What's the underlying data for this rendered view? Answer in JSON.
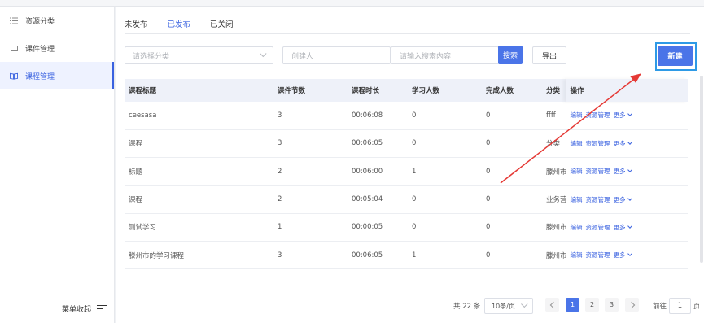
{
  "sidebar": {
    "items": [
      {
        "label": "资源分类",
        "icon": "list-icon",
        "active": false
      },
      {
        "label": "课件管理",
        "icon": "folder-icon",
        "active": false
      },
      {
        "label": "课程管理",
        "icon": "book-icon",
        "active": true
      }
    ],
    "collapse_label": "菜单收起"
  },
  "tabs": [
    {
      "label": "未发布",
      "active": false
    },
    {
      "label": "已发布",
      "active": true
    },
    {
      "label": "已关闭",
      "active": false
    }
  ],
  "filters": {
    "category_placeholder": "请选择分类",
    "creator_placeholder": "创建人",
    "search_placeholder": "请输入搜索内容",
    "search_button": "搜索",
    "export_button": "导出",
    "new_button": "新建"
  },
  "table": {
    "headers": [
      "课程标题",
      "课件节数",
      "课程时长",
      "学习人数",
      "完成人数",
      "分类",
      "操作"
    ],
    "rows": [
      {
        "title": "ceesasa",
        "lessons": "3",
        "duration": "00:06:08",
        "learners": "0",
        "completed": "0",
        "category": "ffff"
      },
      {
        "title": "课程",
        "lessons": "3",
        "duration": "00:06:05",
        "learners": "0",
        "completed": "0",
        "category": "分类"
      },
      {
        "title": "标题",
        "lessons": "2",
        "duration": "00:06:00",
        "learners": "1",
        "completed": "0",
        "category": "滕州市"
      },
      {
        "title": "课程",
        "lessons": "2",
        "duration": "00:05:04",
        "learners": "0",
        "completed": "0",
        "category": "业务营"
      },
      {
        "title": "测试学习",
        "lessons": "1",
        "duration": "00:00:05",
        "learners": "0",
        "completed": "0",
        "category": "滕州市"
      },
      {
        "title": "滕州市的学习课程",
        "lessons": "3",
        "duration": "00:06:05",
        "learners": "1",
        "completed": "0",
        "category": "滕州市"
      }
    ],
    "ops": {
      "edit": "编辑",
      "resources": "资源管理",
      "more": "更多"
    }
  },
  "pagination": {
    "total": "共 22 条",
    "page_size": "10条/页",
    "pages": [
      "1",
      "2",
      "3"
    ],
    "current": "1",
    "goto_label": "前往",
    "goto_value": "1",
    "page_suffix": "页"
  },
  "colors": {
    "accent": "#4a74e8",
    "annotation_arrow": "#e53935",
    "highlight_box": "#2e9ae6"
  }
}
